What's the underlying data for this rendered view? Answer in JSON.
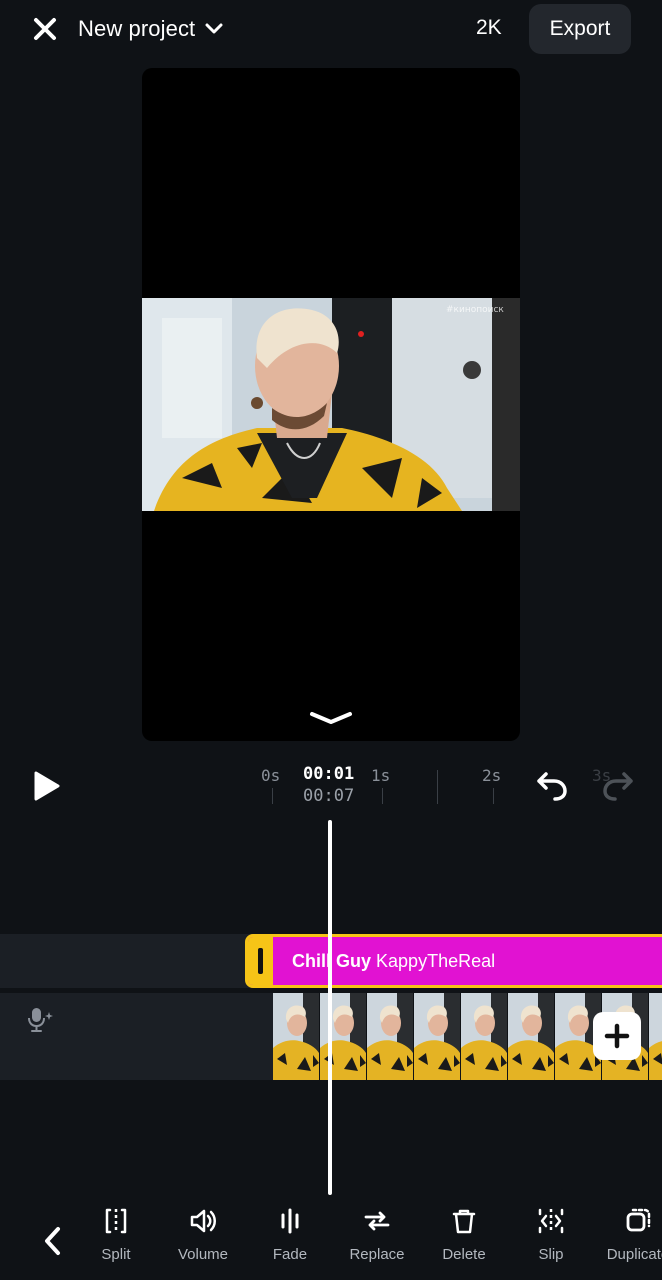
{
  "header": {
    "project_title": "New project",
    "resolution": "2K",
    "export_label": "Export"
  },
  "preview": {
    "watermark": "#кинопоиск"
  },
  "playback": {
    "current_time": "00:01",
    "total_time": "00:07",
    "ruler_labels": [
      "0s",
      "1s",
      "2s",
      "3s"
    ]
  },
  "timeline": {
    "audio_clip": {
      "song": "Chill Guy",
      "artist": "KappyTheReal"
    },
    "video_thumbnail_count": 9
  },
  "toolbar": {
    "tools": [
      {
        "label": "Split",
        "icon": "split-icon"
      },
      {
        "label": "Volume",
        "icon": "volume-icon"
      },
      {
        "label": "Fade",
        "icon": "fade-icon"
      },
      {
        "label": "Replace",
        "icon": "replace-icon"
      },
      {
        "label": "Delete",
        "icon": "trash-icon"
      },
      {
        "label": "Slip",
        "icon": "slip-icon"
      },
      {
        "label": "Duplicate",
        "icon": "duplicate-icon"
      }
    ]
  },
  "colors": {
    "background": "#0f1216",
    "audio_clip": "#e112d2",
    "clip_border": "#f6c417",
    "button_bg": "#23272d"
  }
}
